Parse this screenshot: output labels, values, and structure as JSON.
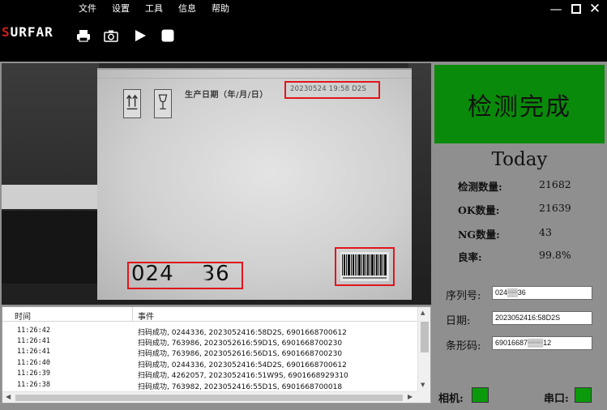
{
  "menu": [
    "文件",
    "设置",
    "工具",
    "信息",
    "帮助"
  ],
  "window_controls": {
    "minimize": "—",
    "close": "✕"
  },
  "brand": {
    "first": "S",
    "rest": "URFAR"
  },
  "toolbar": [
    {
      "name": "printer-icon"
    },
    {
      "name": "camera-icon"
    },
    {
      "name": "play-icon"
    },
    {
      "name": "stop-icon"
    }
  ],
  "camera_view": {
    "production_date_label": "生产日期（年/月/日）",
    "date_readout": "20230524 19:58 D2S",
    "code_readout": "024",
    "code_readout_tail": "36"
  },
  "log": {
    "headers": {
      "time": "时间",
      "event": "事件"
    },
    "rows": [
      {
        "time": "11:26:42",
        "event": "扫码成功, 0244336, 2023052416:58D2S, 6901668700612"
      },
      {
        "time": "11:26:41",
        "event": "扫码成功, 763986, 2023052616:59D1S, 6901668700230"
      },
      {
        "time": "11:26:41",
        "event": "扫码成功, 763986, 2023052616:56D1S, 6901668700230"
      },
      {
        "time": "11:26:40",
        "event": "扫码成功, 0244336, 2023052416:54D2S, 6901668700612"
      },
      {
        "time": "11:26:39",
        "event": "扫码成功, 4262057, 2023052416:51W9S, 6901668929310"
      },
      {
        "time": "11:26:38",
        "event": "扫码成功, 763982, 2023052416:55D1S, 6901668700018"
      }
    ]
  },
  "status": {
    "text": "检测完成",
    "color": "#0a8a0a"
  },
  "today": {
    "title": "Today",
    "stats": [
      {
        "label": "检测数量:",
        "value": "21682"
      },
      {
        "label": "OK数量:",
        "value": "21639"
      },
      {
        "label": "NG数量:",
        "value": "43"
      },
      {
        "label": "良率:",
        "value": "99.8%"
      }
    ]
  },
  "fields": {
    "serial": {
      "label": "序列号:",
      "value": "024▒▒36"
    },
    "date": {
      "label": "日期:",
      "value": "2023052416:58D2S"
    },
    "barcode": {
      "label": "条形码:",
      "value": "69016687▒▒▒12"
    }
  },
  "indicators": {
    "camera": {
      "label": "相机:",
      "color": "#0b9a0b"
    },
    "serial_port": {
      "label": "串口:",
      "color": "#0b9a0b"
    }
  }
}
